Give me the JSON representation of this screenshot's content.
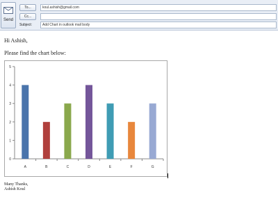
{
  "compose": {
    "send_label": "Send",
    "to_label": "To...",
    "cc_label": "Cc...",
    "subject_label": "Subject:",
    "to_value": "koul.ashish@gmail.com",
    "cc_value": "",
    "subject_value": "Add Chart in outlook mail body"
  },
  "body": {
    "greeting": "Hi Ashish,",
    "intro": "Please find the chart below:",
    "closing": "Many Thanks,",
    "signature": "Ashish Koul"
  },
  "chart_data": {
    "type": "bar",
    "categories": [
      "A",
      "B",
      "C",
      "D",
      "E",
      "F",
      "G"
    ],
    "values": [
      4,
      2,
      3,
      4,
      3,
      2,
      3
    ],
    "colors": [
      "#4a74ab",
      "#b0403d",
      "#8aa84c",
      "#74569a",
      "#3f9cb4",
      "#e8873c",
      "#98a9d3"
    ],
    "ylim": [
      0,
      5
    ],
    "yticks": [
      "0",
      "1",
      "2",
      "3",
      "4",
      "5"
    ],
    "legend": false,
    "grid": false
  }
}
